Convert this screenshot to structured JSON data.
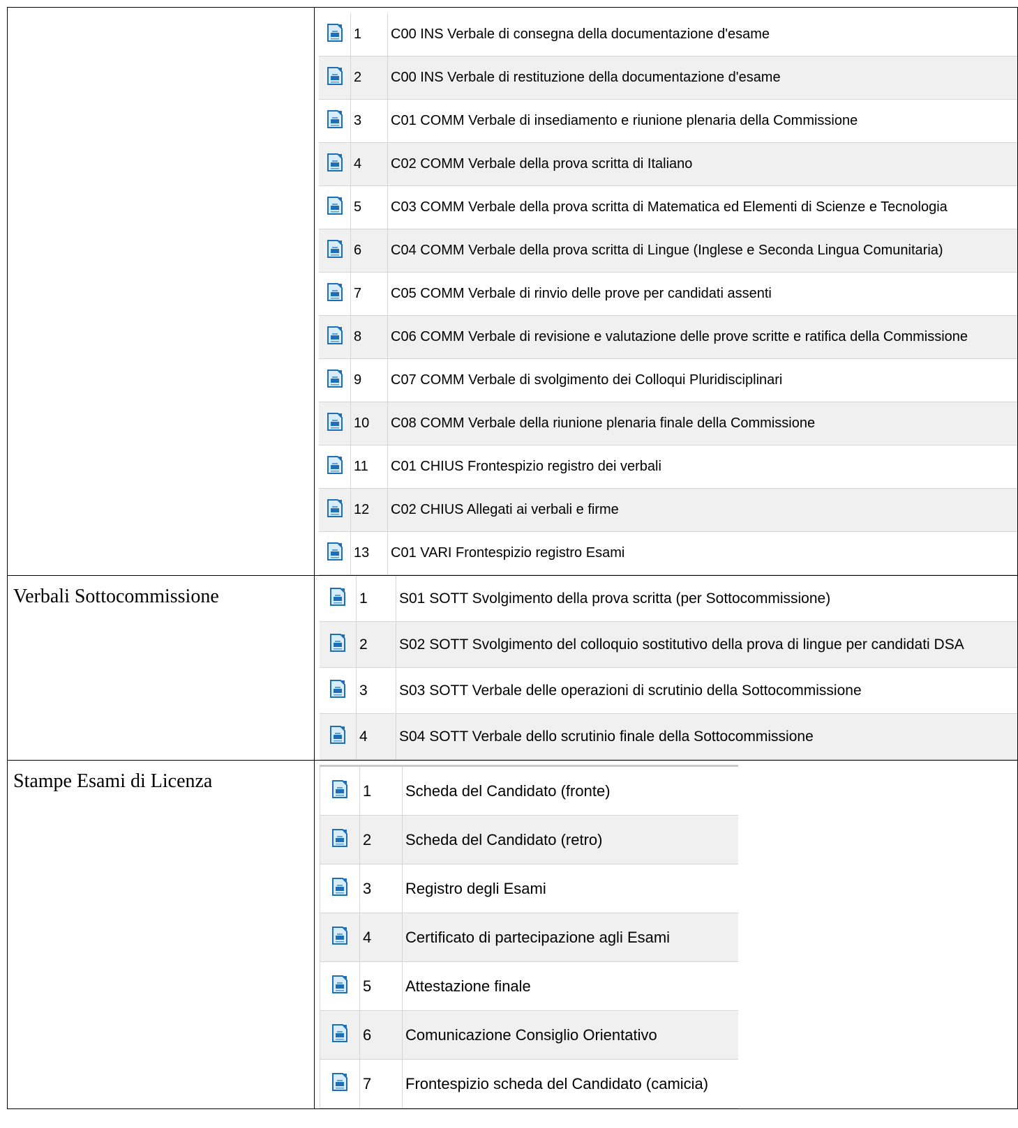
{
  "sections": [
    {
      "label": "",
      "rows": [
        {
          "num": "1",
          "desc": "C00 INS Verbale di consegna della documentazione d'esame"
        },
        {
          "num": "2",
          "desc": "C00 INS Verbale di restituzione della documentazione d'esame"
        },
        {
          "num": "3",
          "desc": "C01 COMM Verbale di insediamento e riunione plenaria della Commissione"
        },
        {
          "num": "4",
          "desc": "C02 COMM Verbale della prova scritta di Italiano"
        },
        {
          "num": "5",
          "desc": "C03 COMM Verbale della prova scritta di Matematica ed Elementi di Scienze e Tecnologia"
        },
        {
          "num": "6",
          "desc": "C04 COMM Verbale della prova scritta di Lingue (Inglese e Seconda Lingua Comunitaria)"
        },
        {
          "num": "7",
          "desc": "C05 COMM Verbale di rinvio delle prove per candidati assenti"
        },
        {
          "num": "8",
          "desc": "C06 COMM Verbale di revisione e valutazione delle prove scritte e ratifica della Commissione"
        },
        {
          "num": "9",
          "desc": "C07 COMM Verbale di svolgimento dei Colloqui Pluridisciplinari"
        },
        {
          "num": "10",
          "desc": "C08 COMM Verbale della riunione plenaria finale della Commissione"
        },
        {
          "num": "11",
          "desc": "C01 CHIUS Frontespizio registro dei verbali"
        },
        {
          "num": "12",
          "desc": "C02 CHIUS Allegati ai verbali e firme"
        },
        {
          "num": "13",
          "desc": "C01 VARI Frontespizio registro Esami"
        }
      ]
    },
    {
      "label": "Verbali Sottocommissione",
      "rows": [
        {
          "num": "1",
          "desc": "S01 SOTT Svolgimento della prova scritta (per Sottocommissione)"
        },
        {
          "num": "2",
          "desc": "S02 SOTT Svolgimento del colloquio sostitutivo della prova di lingue per candidati DSA"
        },
        {
          "num": "3",
          "desc": "S03 SOTT Verbale delle operazioni di scrutinio della Sottocommissione"
        },
        {
          "num": "4",
          "desc": "S04 SOTT Verbale dello scrutinio finale della Sottocommissione"
        }
      ]
    },
    {
      "label": "Stampe Esami di Licenza",
      "rows": [
        {
          "num": "1",
          "desc": "Scheda del Candidato (fronte)"
        },
        {
          "num": "2",
          "desc": "Scheda del Candidato (retro)"
        },
        {
          "num": "3",
          "desc": "Registro degli Esami"
        },
        {
          "num": "4",
          "desc": "Certificato di partecipazione agli Esami"
        },
        {
          "num": "5",
          "desc": "Attestazione finale"
        },
        {
          "num": "6",
          "desc": "Comunicazione Consiglio Orientativo"
        },
        {
          "num": "7",
          "desc": "Frontespizio scheda del Candidato (camicia)"
        }
      ]
    }
  ],
  "icon": "writer-document-icon",
  "colors": {
    "row_alt": "#f0f0f0",
    "grid_line": "#d6d6d6",
    "icon_blue": "#1e6fb8",
    "icon_light": "#d9ecfa"
  }
}
